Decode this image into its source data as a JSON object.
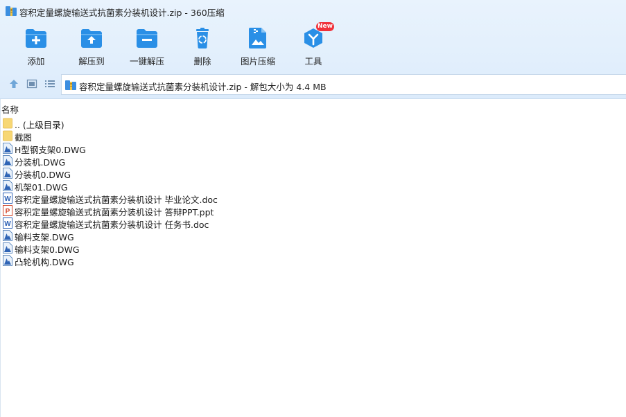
{
  "window": {
    "title": "容积定量螺旋输送式抗菌素分装机设计.zip - 360压缩",
    "app_icon": "360zip-archive-icon"
  },
  "toolbar": [
    {
      "label": "添加",
      "icon": "add-folder-icon"
    },
    {
      "label": "解压到",
      "icon": "extract-to-folder-icon"
    },
    {
      "label": "一键解压",
      "icon": "one-click-extract-icon"
    },
    {
      "label": "删除",
      "icon": "recycle-bin-icon"
    },
    {
      "label": "图片压缩",
      "icon": "image-compress-icon"
    },
    {
      "label": "工具",
      "icon": "tools-icon",
      "badge": "New"
    }
  ],
  "nav": {
    "up_icon": "up-arrow-icon",
    "view_icon": "view-mode-icon",
    "list_icon": "list-view-icon",
    "address": "容积定量螺旋输送式抗菌素分装机设计.zip - 解包大小为 4.4 MB"
  },
  "columns": {
    "name": "名称"
  },
  "files": [
    {
      "name": ".. (上级目录)",
      "type": "folder"
    },
    {
      "name": "截图",
      "type": "folder"
    },
    {
      "name": "H型钢支架0.DWG",
      "type": "dwg"
    },
    {
      "name": "分装机.DWG",
      "type": "dwg"
    },
    {
      "name": "分装机0.DWG",
      "type": "dwg"
    },
    {
      "name": "机架01.DWG",
      "type": "dwg"
    },
    {
      "name": "容积定量螺旋输送式抗菌素分装机设计 毕业论文.doc",
      "type": "doc"
    },
    {
      "name": "容积定量螺旋输送式抗菌素分装机设计 答辩PPT.ppt",
      "type": "ppt"
    },
    {
      "name": "容积定量螺旋输送式抗菌素分装机设计 任务书.doc",
      "type": "doc"
    },
    {
      "name": "输料支架.DWG",
      "type": "dwg"
    },
    {
      "name": "输料支架0.DWG",
      "type": "dwg"
    },
    {
      "name": "凸轮机构.DWG",
      "type": "dwg"
    }
  ],
  "colors": {
    "accent": "#2a8fe6",
    "header_bg": "#e2effc",
    "badge": "#f0313a"
  }
}
